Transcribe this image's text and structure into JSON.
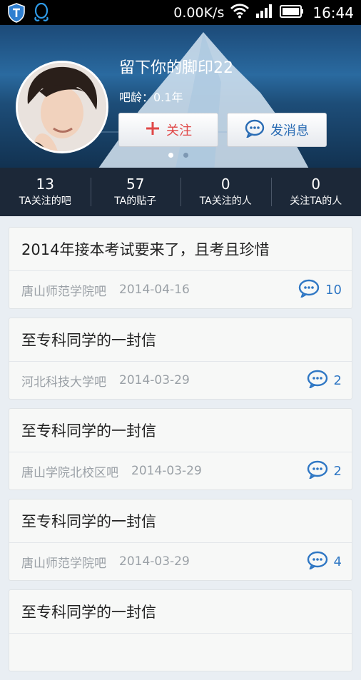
{
  "status_bar": {
    "net_speed": "0.00K/s",
    "time": "16:44"
  },
  "profile": {
    "username": "留下你的脚印22",
    "age": "吧龄：0.1年",
    "follow_label": "关注",
    "message_label": "发消息"
  },
  "stats": [
    {
      "num": "13",
      "label": "TA关注的吧"
    },
    {
      "num": "57",
      "label": "TA的贴子"
    },
    {
      "num": "0",
      "label": "TA关注的人"
    },
    {
      "num": "0",
      "label": "关注TA的人"
    }
  ],
  "posts": [
    {
      "title": "2014年接本考试要来了，且考且珍惜",
      "forum": "唐山师范学院吧",
      "date": "2014-04-16",
      "comments": "10"
    },
    {
      "title": "至专科同学的一封信",
      "forum": "河北科技大学吧",
      "date": "2014-03-29",
      "comments": "2"
    },
    {
      "title": "至专科同学的一封信",
      "forum": "唐山学院北校区吧",
      "date": "2014-03-29",
      "comments": "2"
    },
    {
      "title": "至专科同学的一封信",
      "forum": "唐山师范学院吧",
      "date": "2014-03-29",
      "comments": "4"
    },
    {
      "title": "至专科同学的一封信",
      "forum": "",
      "date": "",
      "comments": ""
    }
  ],
  "colors": {
    "accent": "#2f77c4",
    "follow": "#e04848",
    "stats_bg": "#1c2838"
  }
}
